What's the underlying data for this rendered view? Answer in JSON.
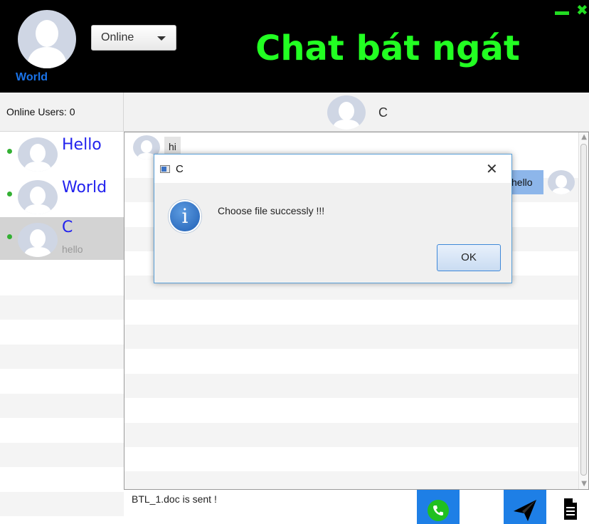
{
  "header": {
    "app_title": "Chat bát ngát",
    "profile_name": "World",
    "status_value": "Online"
  },
  "sidebar": {
    "online_users_label": "Online Users:  0",
    "users": [
      {
        "name": "Hello",
        "preview": "",
        "online": true
      },
      {
        "name": "World",
        "preview": "",
        "online": true
      },
      {
        "name": "C",
        "preview": "hello",
        "online": true,
        "selected": true
      }
    ]
  },
  "chat": {
    "contact_name": "C",
    "messages": [
      {
        "direction": "incoming",
        "text": "hi"
      },
      {
        "direction": "outgoing",
        "text": "hello"
      }
    ],
    "input_text": "BTL_1.doc is sent !"
  },
  "toolbar": {
    "call_icon": "phone-icon",
    "send_icon": "send-plane-icon",
    "file_icon": "document-icon"
  },
  "dialog": {
    "title": "C",
    "message": "Choose file successly !!!",
    "ok_label": "OK",
    "icon": "info-icon"
  },
  "colors": {
    "header_bg": "#000000",
    "title_green": "#22ff22",
    "accent_blue": "#1e7fe6",
    "user_name_blue": "#2222ee"
  }
}
